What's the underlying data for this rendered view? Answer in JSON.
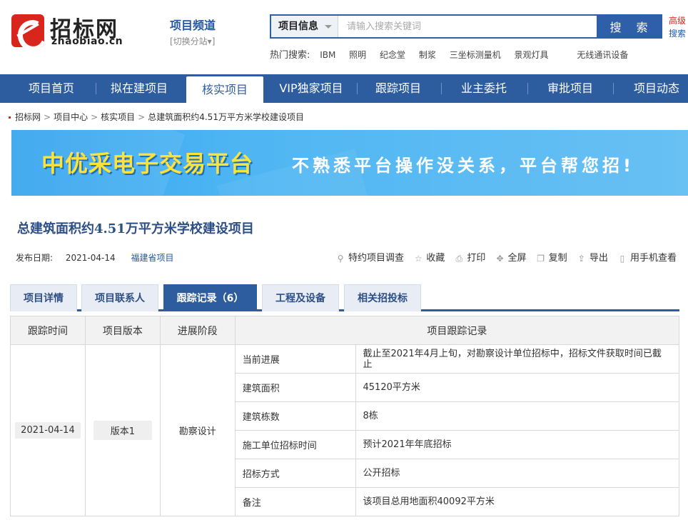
{
  "header": {
    "logo_cn": "招标网",
    "logo_en": "zhaobiao.cn",
    "channel_title": "项目频道",
    "channel_switch": "[切换分站▾]",
    "search": {
      "category": "项目信息",
      "placeholder": "请输入搜索关键词",
      "button_label": "搜 索"
    },
    "advanced_1": "高级",
    "advanced_2": "搜索",
    "hot_label": "热门搜索:",
    "hot_items": [
      "IBM",
      "照明",
      "纪念堂",
      "制浆",
      "三坐标测量机",
      "景观灯具",
      "无线通讯设备"
    ]
  },
  "nav": {
    "items": [
      "项目首页",
      "拟在建项目",
      "核实项目",
      "VIP独家项目",
      "跟踪项目",
      "业主委托",
      "审批项目",
      "项目动态"
    ],
    "active_index": 2
  },
  "breadcrumb": [
    "招标网",
    "项目中心",
    "核实项目",
    "总建筑面积约4.51万平方米学校建设项目"
  ],
  "banner": {
    "title": "中优采电子交易平台",
    "slogan": "不熟悉平台操作没关系，平台帮您招!"
  },
  "project": {
    "title": "总建筑面积约4.51万平方米学校建设项目",
    "date_label": "发布日期:",
    "date": "2021-04-14",
    "region": "福建省项目"
  },
  "actions": [
    "特约项目调查",
    "收藏",
    "打印",
    "全屏",
    "复制",
    "导出",
    "用手机查看"
  ],
  "tabs": {
    "items": [
      "项目详情",
      "项目联系人",
      "跟踪记录（6）",
      "工程及设备",
      "相关招投标"
    ],
    "active_index": 2
  },
  "table": {
    "headers": [
      "跟踪时间",
      "项目版本",
      "进展阶段",
      "项目跟踪记录"
    ],
    "date": "2021-04-14",
    "version": "版本1",
    "stage": "勘察设计",
    "records": [
      {
        "label": "当前进展",
        "value": "截止至2021年4月上旬，对勘察设计单位招标中，招标文件获取时间已截止"
      },
      {
        "label": "建筑面积",
        "value": "45120平方米"
      },
      {
        "label": "建筑栋数",
        "value": "8栋"
      },
      {
        "label": "施工单位招标时间",
        "value": "预计2021年年底招标"
      },
      {
        "label": "招标方式",
        "value": "公开招标"
      },
      {
        "label": "备注",
        "value": "该项目总用地面积40092平方米"
      }
    ]
  },
  "colors": {
    "brand_red": "#d9261c",
    "nav_blue": "#2d5d9f",
    "title_blue": "#2d4f86",
    "banner_yellow": "#fde23a"
  }
}
